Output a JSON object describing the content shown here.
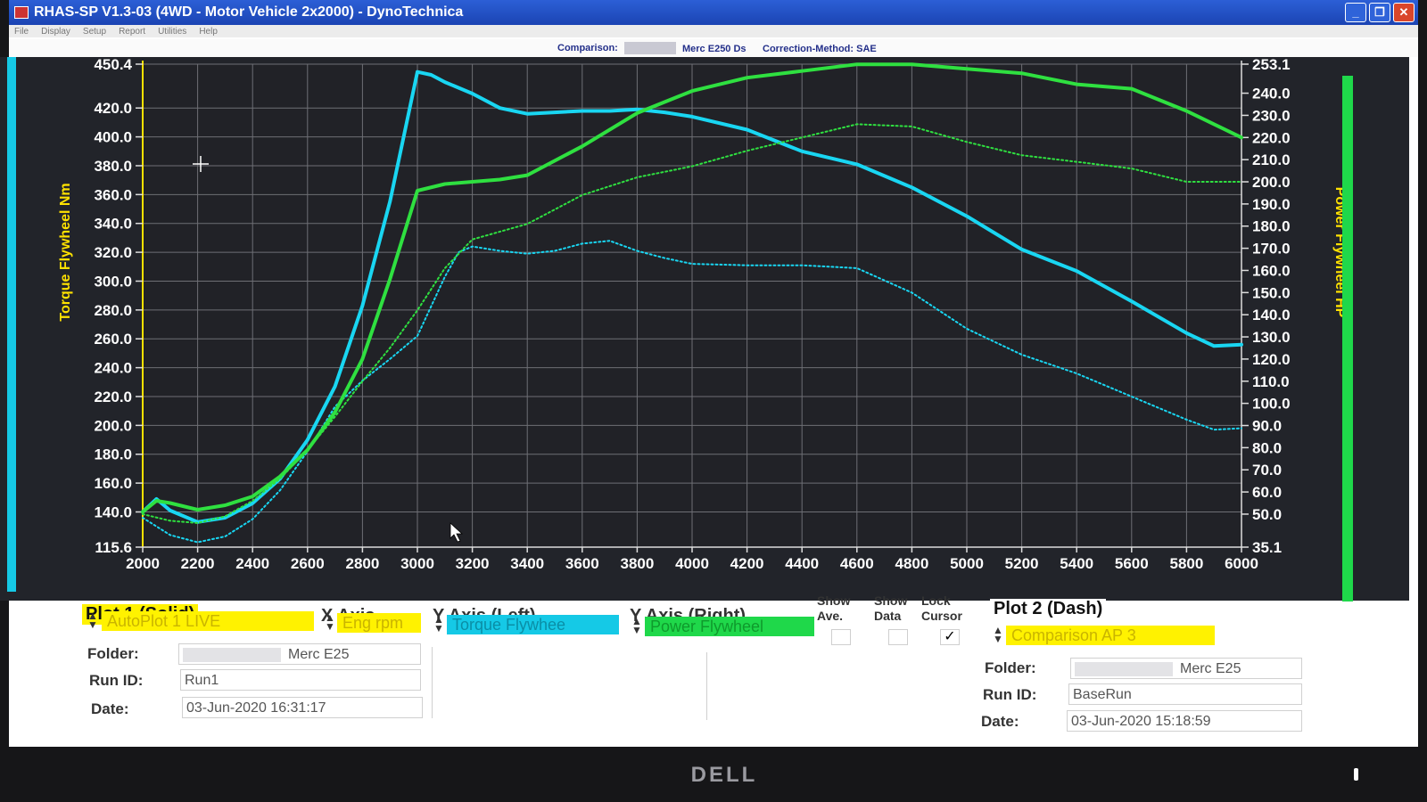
{
  "window": {
    "title": "RHAS-SP V1.3-03  (4WD - Motor Vehicle 2x2000) - DynoTechnica",
    "menu": [
      "File",
      "Display",
      "Setup",
      "Report",
      "Utilities",
      "Help"
    ],
    "buttons": [
      "_",
      "❐",
      "✕"
    ]
  },
  "compare_bar": {
    "comparison_label": "Comparison:",
    "comparison_value": "Merc E250 Ds",
    "correction": "Correction-Method: SAE"
  },
  "chart_data": {
    "type": "line",
    "x_axis": {
      "label": "",
      "range": [
        2000,
        6000
      ],
      "ticks": [
        2000,
        2200,
        2400,
        2600,
        2800,
        3000,
        3200,
        3400,
        3600,
        3800,
        4000,
        4200,
        4400,
        4600,
        4800,
        5000,
        5200,
        5400,
        5600,
        5800,
        6000
      ]
    },
    "y_left": {
      "label": "Torque Flywheel Nm",
      "range": [
        115.6,
        450.4
      ],
      "tick_labels": [
        "450.4",
        "420.0",
        "400.0",
        "380.0",
        "360.0",
        "340.0",
        "320.0",
        "300.0",
        "280.0",
        "260.0",
        "240.0",
        "220.0",
        "200.0",
        "180.0",
        "160.0",
        "140.0",
        "115.6"
      ],
      "color": "#ffe200"
    },
    "y_right": {
      "label": "Power Flywheel HP",
      "range": [
        35.1,
        253.1
      ],
      "tick_labels": [
        "253.1",
        "240.0",
        "230.0",
        "220.0",
        "210.0",
        "200.0",
        "190.0",
        "180.0",
        "170.0",
        "160.0",
        "150.0",
        "140.0",
        "130.0",
        "120.0",
        "110.0",
        "100.0",
        "90.0",
        "80.0",
        "70.0",
        "60.0",
        "50.0",
        "35.1"
      ],
      "color": "#ffe200"
    },
    "grid": true,
    "series": [
      {
        "axis": "left",
        "style": "solid",
        "color": "#19d6f2",
        "x": [
          2000,
          2050,
          2100,
          2200,
          2300,
          2400,
          2500,
          2600,
          2700,
          2800,
          2900,
          3000,
          3050,
          3100,
          3200,
          3300,
          3400,
          3500,
          3600,
          3700,
          3800,
          3900,
          4000,
          4200,
          4400,
          4600,
          4800,
          5000,
          5200,
          5400,
          5600,
          5800,
          5900,
          6000
        ],
        "y": [
          140,
          149,
          141,
          133,
          136,
          146,
          163,
          190,
          227,
          283,
          355,
          445,
          443,
          438,
          430,
          420,
          416,
          417,
          418,
          418,
          419,
          417,
          414,
          405,
          390,
          381,
          365,
          345,
          322,
          307,
          286,
          264,
          255,
          256
        ]
      },
      {
        "axis": "left",
        "style": "dash",
        "color": "#19d6f2",
        "x": [
          2000,
          2100,
          2200,
          2300,
          2400,
          2500,
          2600,
          2700,
          2800,
          2900,
          3000,
          3100,
          3150,
          3200,
          3300,
          3400,
          3500,
          3600,
          3700,
          3800,
          3900,
          4000,
          4200,
          4400,
          4600,
          4800,
          5000,
          5200,
          5400,
          5600,
          5800,
          5900,
          6000
        ],
        "y": [
          136,
          124,
          119,
          123,
          135,
          155,
          182,
          213,
          231,
          246,
          262,
          303,
          320,
          324,
          321,
          319,
          321,
          326,
          328,
          321,
          316,
          312,
          311,
          311,
          309,
          292,
          267,
          249,
          236,
          220,
          204,
          197,
          198
        ]
      },
      {
        "axis": "right",
        "style": "solid",
        "color": "#2fe040",
        "x": [
          2000,
          2050,
          2100,
          2200,
          2300,
          2400,
          2500,
          2600,
          2700,
          2800,
          2900,
          3000,
          3100,
          3200,
          3300,
          3400,
          3600,
          3800,
          4000,
          4200,
          4400,
          4600,
          4800,
          5000,
          5200,
          5400,
          5600,
          5800,
          6000
        ],
        "y": [
          51,
          56,
          55,
          52,
          54,
          58,
          67,
          79,
          96,
          120,
          156,
          196,
          199,
          200,
          201,
          203,
          216,
          231,
          241,
          247,
          250,
          253,
          253,
          251,
          249,
          244,
          242,
          232,
          220
        ]
      },
      {
        "axis": "right",
        "style": "dash",
        "color": "#2fe040",
        "x": [
          2000,
          2100,
          2200,
          2300,
          2400,
          2500,
          2600,
          2700,
          2800,
          2900,
          3000,
          3100,
          3200,
          3400,
          3600,
          3800,
          4000,
          4200,
          4400,
          4600,
          4800,
          5000,
          5200,
          5400,
          5600,
          5800,
          6000
        ],
        "y": [
          50,
          47,
          46,
          49,
          56,
          66,
          79,
          94,
          110,
          125,
          142,
          161,
          174,
          181,
          194,
          202,
          207,
          214,
          220,
          226,
          225,
          218,
          212,
          209,
          206,
          200,
          200
        ]
      }
    ]
  },
  "panel": {
    "plot1_title": "Plot 1 (Solid)",
    "x_axis_title": "X Axis",
    "y_left_title": "Y Axis (Left)",
    "y_right_title": "Y Axis (Right)",
    "show_ave": "Show Ave.",
    "show_data": "Show Data",
    "lock_cursor": "Lock Cursor",
    "plot1_select": "AutoPlot 1 LIVE",
    "x_select": "Eng rpm",
    "y_left_select": "Torque Flywhee",
    "y_right_select": "Power Flywheel",
    "plot1_folder_label": "Folder:",
    "plot1_folder": "Merc E25",
    "plot1_runid_label": "Run ID:",
    "plot1_runid": "Run1",
    "plot1_date_label": "Date:",
    "plot1_date": "03-Jun-2020  16:31:17",
    "lock_check": "✓",
    "plot2_title": "Plot 2 (Dash)",
    "plot2_select": "Comparison AP 3",
    "plot2_folder_label": "Folder:",
    "plot2_folder": "Merc E25",
    "plot2_runid_label": "Run ID:",
    "plot2_runid": "BaseRun",
    "plot2_date_label": "Date:",
    "plot2_date": "03-Jun-2020  15:18:59"
  },
  "monitor": {
    "brand": "DELL"
  }
}
